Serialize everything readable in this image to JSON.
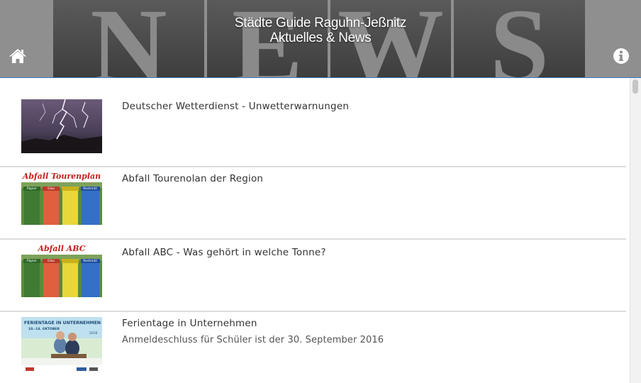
{
  "header": {
    "title_line1": "Städte Guide Raguhn-Jeßnitz",
    "title_line2": "Aktuelles & News",
    "banner_letters": [
      "N",
      "E",
      "W",
      "S"
    ],
    "home_icon": "home-icon",
    "info_icon": "info-icon"
  },
  "colors": {
    "header_border": "#3c7fc0",
    "divider": "#dcdcdc",
    "title_text": "#333333"
  },
  "items": [
    {
      "title": "Deutscher Wetterdienst - Unwetterwarnungen",
      "subtitle": "",
      "thumb": "lightning-image"
    },
    {
      "title": "Abfall Tourenolan der Region",
      "subtitle": "",
      "thumb": "waste-bins-image",
      "thumb_caption": "Abfall Tourenplan",
      "bin_labels": [
        "Papier",
        "Glas",
        "",
        "Restmüll"
      ]
    },
    {
      "title": "Abfall ABC - Was gehört in welche Tonne?",
      "subtitle": "",
      "thumb": "waste-bins-image",
      "thumb_caption": "Abfall ABC",
      "bin_labels": [
        "Papier",
        "Glas",
        "",
        "Restmüll"
      ]
    },
    {
      "title": "Ferientage in Unternehmen",
      "subtitle": "Anmeldeschluss für Schüler ist der 30. September 2016",
      "thumb": "ferientage-image",
      "thumb_caption": "FERIENTAGE IN UNTERNEHMEN",
      "thumb_dates": "10.–14. OKTOBER",
      "thumb_year": "2016"
    }
  ]
}
